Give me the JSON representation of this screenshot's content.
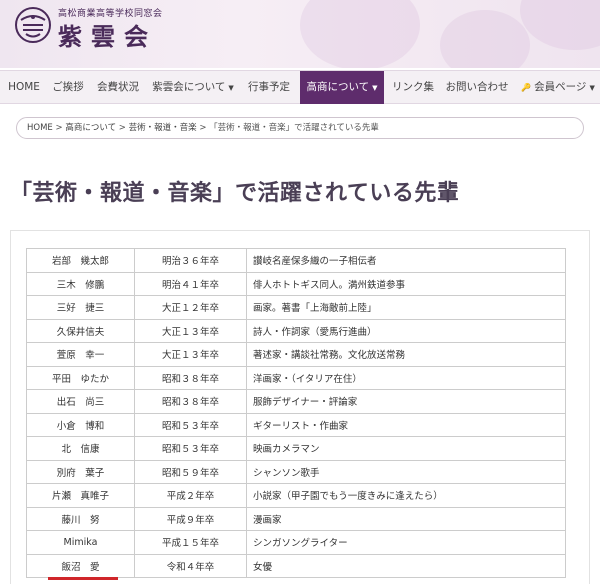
{
  "header": {
    "subtitle": "高松商業高等学校同窓会",
    "brand": "紫雲会"
  },
  "nav": {
    "items": [
      {
        "label": "HOME",
        "has_caret": false
      },
      {
        "label": "ご挨拶",
        "has_caret": false
      },
      {
        "label": "会費状況",
        "has_caret": false
      },
      {
        "label": "紫雲会について",
        "has_caret": true
      },
      {
        "label": "行事予定",
        "has_caret": false
      },
      {
        "label": "高商について",
        "has_caret": true,
        "active": true
      },
      {
        "label": "リンク集",
        "has_caret": false
      },
      {
        "label": "お問い合わせ",
        "has_caret": false
      },
      {
        "label": "会員ページ",
        "has_caret": true,
        "icon": "key-icon"
      }
    ],
    "caret_glyph": "▼",
    "key_glyph": "🔑"
  },
  "breadcrumb": {
    "home": "HOME",
    "sep": " > ",
    "parent": "高商について",
    "current_1": "芸術・報道・音楽",
    "current_2": "「芸術・報道・音楽」で活躍されている先輩"
  },
  "page": {
    "title": "「芸術・報道・音楽」で活躍されている先輩"
  },
  "table": {
    "rows": [
      {
        "name": "岩部　幾太郎",
        "grad": "明治３６年卒",
        "desc": "讃岐名産保多織の一子相伝者"
      },
      {
        "name": "三木　修鵬",
        "grad": "明治４１年卒",
        "desc": "俳人ホトトギス同人。満州鉄道参事"
      },
      {
        "name": "三好　捷三",
        "grad": "大正１２年卒",
        "desc": "画家。著書「上海敵前上陸」"
      },
      {
        "name": "久保井信夫",
        "grad": "大正１３年卒",
        "desc": "詩人・作詞家（愛馬行進曲）"
      },
      {
        "name": "萱原　幸一",
        "grad": "大正１３年卒",
        "desc": "著述家・講談社常務。文化放送常務"
      },
      {
        "name": "平田　ゆたか",
        "grad": "昭和３８年卒",
        "desc": "洋画家・（イタリア在住）"
      },
      {
        "name": "出石　尚三",
        "grad": "昭和３８年卒",
        "desc": "服飾デザイナー・評論家"
      },
      {
        "name": "小倉　博和",
        "grad": "昭和５３年卒",
        "desc": "ギターリスト・作曲家"
      },
      {
        "name": "北　信康",
        "grad": "昭和５３年卒",
        "desc": "映画カメラマン"
      },
      {
        "name": "別府　葉子",
        "grad": "昭和５９年卒",
        "desc": "シャンソン歌手"
      },
      {
        "name": "片瀬　真唯子",
        "grad": "平成２年卒",
        "desc": "小説家（甲子園でもう一度きみに逢えたら）"
      },
      {
        "name": "藤川　努",
        "grad": "平成９年卒",
        "desc": "漫画家"
      },
      {
        "name": "Mimika",
        "grad": "平成１５年卒",
        "desc": "シンガソングライター"
      },
      {
        "name": "飯沼　愛",
        "grad": "令和４年卒",
        "desc": "女優"
      }
    ]
  },
  "colors": {
    "accent": "#5e2c6c",
    "brand_text": "#4a2a5a",
    "highlight_underline": "#d0262a"
  }
}
